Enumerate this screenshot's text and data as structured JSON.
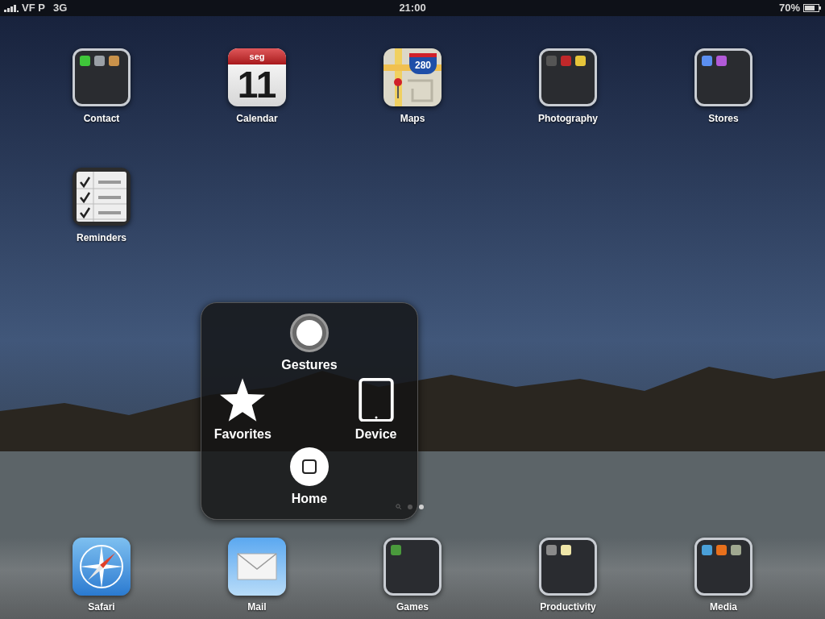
{
  "status_bar": {
    "carrier": "VF P",
    "network": "3G",
    "time": "21:00",
    "battery": "70%"
  },
  "apps": [
    {
      "kind": "folder",
      "label": "Contact",
      "minis": [
        {
          "color": "#3fc63a"
        },
        {
          "color": "#9aa0a6"
        },
        {
          "color": "#c9924a"
        }
      ]
    },
    {
      "kind": "calendar",
      "label": "Calendar",
      "day_name": "seg",
      "day": "11"
    },
    {
      "kind": "maps",
      "label": "Maps",
      "route": "280"
    },
    {
      "kind": "folder",
      "label": "Photography",
      "minis": [
        {
          "color": "#555555"
        },
        {
          "color": "#c0282a"
        },
        {
          "color": "#e6c53a"
        }
      ]
    },
    {
      "kind": "folder",
      "label": "Stores",
      "minis": [
        {
          "color": "#5b8ff0"
        },
        {
          "color": "#b25ad8"
        }
      ]
    },
    {
      "kind": "reminders",
      "label": "Reminders"
    }
  ],
  "assistive_menu": [
    {
      "kind": "gestures",
      "label": "Gestures"
    },
    {
      "kind": "favorites",
      "label": "Favorites"
    },
    {
      "kind": "device",
      "label": "Device"
    },
    {
      "kind": "home",
      "label": "Home"
    }
  ],
  "page_dots": [
    {
      "kind": "search",
      "selected": false
    },
    {
      "kind": "page",
      "selected": false
    },
    {
      "kind": "page",
      "selected": true
    }
  ],
  "dock": [
    {
      "kind": "safari",
      "label": "Safari"
    },
    {
      "kind": "mail",
      "label": "Mail"
    },
    {
      "kind": "folder",
      "label": "Games",
      "minis": [
        {
          "color": "#4a9a3c"
        }
      ]
    },
    {
      "kind": "folder",
      "label": "Productivity",
      "minis": [
        {
          "color": "#8a8a8a"
        },
        {
          "color": "#efe6a8"
        }
      ]
    },
    {
      "kind": "folder",
      "label": "Media",
      "minis": [
        {
          "color": "#4aa0d8"
        },
        {
          "color": "#e8701c"
        },
        {
          "color": "#a0a890"
        }
      ]
    }
  ]
}
